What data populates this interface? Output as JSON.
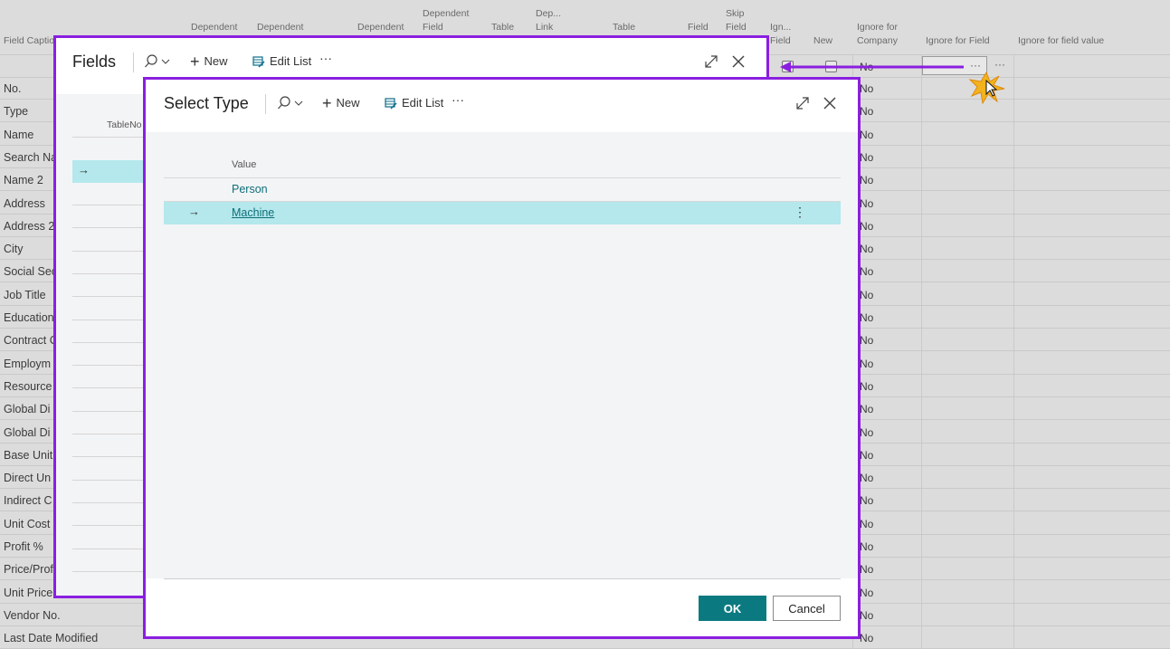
{
  "background": {
    "column_headers": [
      {
        "text": "Field Caption",
        "x": 4,
        "lines": [
          "",
          "",
          "Field Captio"
        ]
      },
      {
        "text": "Dependent",
        "lines": [
          "",
          "Dependent"
        ]
      },
      {
        "text": "Dependent",
        "lines": [
          "",
          "Dependent"
        ]
      },
      {
        "text": "Dependent",
        "lines": [
          "",
          "Dependent"
        ]
      },
      {
        "text": "Dependent Field",
        "lines": [
          "Dependent",
          "Field"
        ]
      },
      {
        "text": "Table",
        "lines": [
          "",
          "Table"
        ]
      },
      {
        "text": "Dep... Link",
        "lines": [
          "Dep...",
          "Link"
        ]
      },
      {
        "text": "Table",
        "lines": [
          "",
          "Table"
        ]
      },
      {
        "text": "Field",
        "lines": [
          "",
          "Field"
        ]
      },
      {
        "text": "Skip Field",
        "lines": [
          "Skip",
          "Field"
        ]
      },
      {
        "text": "Ign... Field",
        "lines": [
          "Ign...",
          "Field"
        ]
      },
      {
        "text": "New",
        "lines": [
          "",
          "New"
        ]
      },
      {
        "text": "Ignore for Company",
        "lines": [
          "Ignore for",
          "Company"
        ]
      },
      {
        "text": "Ignore for Field",
        "lines": [
          "",
          "Ignore for Field"
        ]
      },
      {
        "text": "Ignore for field value",
        "lines": [
          "",
          "Ignore for field value"
        ]
      }
    ],
    "header_texts": {
      "field_caption": "Field Captio",
      "dependent_1": "Dependent",
      "dependent_2": "Dependent",
      "dependent_3": "Dependent",
      "dependent_field_1": "Dependent",
      "dependent_field_2": "Field",
      "table_1": "Table",
      "dep_link_1": "Dep...",
      "dep_link_2": "Link",
      "table_2": "Table",
      "field": "Field",
      "skip_field_1": "Skip",
      "skip_field_2": "Field",
      "ign_field_1": "Ign...",
      "ign_field_2": "Field",
      "new": "New",
      "ignore_company_1": "Ignore for",
      "ignore_company_2": "Company",
      "ignore_for_field": "Ignore for Field",
      "ignore_for_field_value": "Ignore for field value"
    },
    "rows": [
      "No.",
      "Type",
      "Name",
      "Search Na",
      "Name 2",
      "Address",
      "Address 2",
      "City",
      "Social Sec",
      "Job Title",
      "Education",
      "Contract C",
      "Employm",
      "Resource",
      "Global Di",
      "Global Di",
      "Base Unit",
      "Direct Un",
      "Indirect C",
      "Unit Cost",
      "Profit %",
      "Price/Prof",
      "Unit Price",
      "Vendor No.",
      "Last Date Modified"
    ],
    "no_value": "No",
    "ellipsis": "···"
  },
  "fields_dialog": {
    "title": "Fields",
    "new_label": "New",
    "edit_list_label": "Edit List",
    "more": "···",
    "col_tableno": "TableNo"
  },
  "select_type_dialog": {
    "title": "Select Type",
    "new_label": "New",
    "edit_list_label": "Edit List",
    "more": "···",
    "column_header": "Value",
    "items": [
      "Person",
      "Machine"
    ],
    "selected_index": 1,
    "ok_label": "OK",
    "cancel_label": "Cancel"
  },
  "colors": {
    "accent_purple": "#8a1fe0",
    "ok_teal": "#0b7a80",
    "selection": "#b4e8ec",
    "link": "#0e6e78"
  }
}
